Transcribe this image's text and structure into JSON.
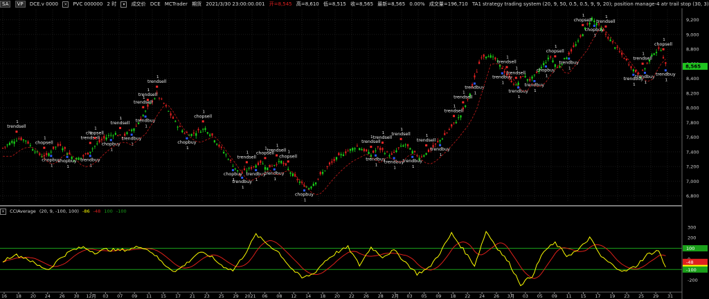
{
  "header": {
    "symbol_button": "SA",
    "vp_button": "VP",
    "symbol": "DCE.v 0000",
    "icon_names": [
      "close-icon",
      "settings-icon"
    ],
    "contract": "PVC 000000",
    "period": "2 时",
    "periodic_label": "成交价",
    "exchange": "DCE",
    "source": "MCTrader",
    "type_label": "期货",
    "datetime": "2021/3/30 23:00:00.001",
    "open_label": "开=8,545",
    "high_label": "高=8,610",
    "low_label": "低=8,515",
    "close_label": "收=8,565",
    "last_label": "最新=8,565",
    "change_label": "0.00%",
    "volume_label": "成交量=196,710",
    "strategy_label": "TA1 strategy trading system (20, 9, 50, 0.5, 0.5, 9, 9, 20); position manage-4 atr trail stop (30, 3)"
  },
  "price_axis": {
    "ticks": [
      "9,200",
      "9,000",
      "8,800",
      "8,600",
      "8,400",
      "8,200",
      "8,000",
      "7,800",
      "7,600",
      "7,400",
      "7,200",
      "7,000",
      "6,800"
    ],
    "last_price_label": "8,565",
    "last_price_color": "#1fc41f"
  },
  "indicator": {
    "title": "CCIAverage",
    "params": "(20, 9, -100, 100)",
    "value1": "-86",
    "value2": "-48",
    "value3": "100",
    "value4": "-100",
    "axis_ticks": [
      "300",
      "200",
      "100",
      "0",
      "-100",
      "-200"
    ],
    "badges": [
      "100",
      "-48",
      "-86",
      "-100"
    ],
    "colors": {
      "cci": "#ffff00",
      "avg": "#e0201a",
      "levels": "#1aa01a"
    }
  },
  "date_axis": {
    "labels": [
      "16",
      "18",
      "20",
      "24",
      "26",
      "30",
      "12月",
      "03",
      "07",
      "09",
      "11",
      "15",
      "17",
      "21",
      "23",
      "25",
      "29",
      "2021",
      "06",
      "08",
      "12",
      "14",
      "18",
      "20",
      "22",
      "26",
      "28",
      "2月",
      "03",
      "05",
      "09",
      "18",
      "22",
      "24",
      "26",
      "3月",
      "03",
      "05",
      "09",
      "11",
      "15",
      "17",
      "19",
      "23",
      "25",
      "29",
      "31"
    ]
  },
  "signals": [
    {
      "label": "trendsell"
    },
    {
      "label": "chopsell"
    },
    {
      "label": "chopbuy"
    },
    {
      "label": "trendbuy"
    },
    {
      "label": "1"
    }
  ],
  "chart_data": {
    "type": "candlestick",
    "price_axis": {
      "min": 6800,
      "max": 9300,
      "ticks": [
        6800,
        7000,
        7200,
        7400,
        7600,
        7800,
        8000,
        8200,
        8400,
        8600,
        8800,
        9000,
        9200
      ]
    },
    "close_path": [
      [
        0,
        7450
      ],
      [
        4,
        7540
      ],
      [
        7,
        7580
      ],
      [
        10,
        7560
      ],
      [
        13,
        7450
      ],
      [
        16,
        7360
      ],
      [
        19,
        7340
      ],
      [
        22,
        7450
      ],
      [
        25,
        7500
      ],
      [
        28,
        7400
      ],
      [
        31,
        7300
      ],
      [
        34,
        7320
      ],
      [
        37,
        7380
      ],
      [
        40,
        7480
      ],
      [
        43,
        7560
      ],
      [
        46,
        7620
      ],
      [
        49,
        7650
      ],
      [
        52,
        7600
      ],
      [
        55,
        7680
      ],
      [
        58,
        7750
      ],
      [
        61,
        7900
      ],
      [
        64,
        8050
      ],
      [
        67,
        8180
      ],
      [
        70,
        8060
      ],
      [
        73,
        7900
      ],
      [
        76,
        7760
      ],
      [
        79,
        7660
      ],
      [
        82,
        7640
      ],
      [
        85,
        7680
      ],
      [
        88,
        7720
      ],
      [
        91,
        7620
      ],
      [
        94,
        7480
      ],
      [
        97,
        7360
      ],
      [
        100,
        7220
      ],
      [
        103,
        7100
      ],
      [
        106,
        7150
      ],
      [
        109,
        7200
      ],
      [
        112,
        7260
      ],
      [
        115,
        7180
      ],
      [
        118,
        7230
      ],
      [
        121,
        7270
      ],
      [
        124,
        7160
      ],
      [
        127,
        7050
      ],
      [
        130,
        6960
      ],
      [
        133,
        6910
      ],
      [
        136,
        7000
      ],
      [
        139,
        7120
      ],
      [
        142,
        7220
      ],
      [
        145,
        7310
      ],
      [
        148,
        7380
      ],
      [
        151,
        7430
      ],
      [
        154,
        7480
      ],
      [
        157,
        7420
      ],
      [
        160,
        7360
      ],
      [
        163,
        7450
      ],
      [
        166,
        7400
      ],
      [
        169,
        7350
      ],
      [
        172,
        7450
      ],
      [
        175,
        7500
      ],
      [
        178,
        7400
      ],
      [
        181,
        7330
      ],
      [
        184,
        7380
      ],
      [
        187,
        7460
      ],
      [
        190,
        7560
      ],
      [
        193,
        7660
      ],
      [
        196,
        7780
      ],
      [
        199,
        7900
      ],
      [
        202,
        8100
      ],
      [
        205,
        8400
      ],
      [
        208,
        8700
      ],
      [
        211,
        8720
      ],
      [
        214,
        8660
      ],
      [
        217,
        8540
      ],
      [
        220,
        8400
      ],
      [
        223,
        8300
      ],
      [
        226,
        8440
      ],
      [
        229,
        8380
      ],
      [
        232,
        8460
      ],
      [
        235,
        8600
      ],
      [
        238,
        8700
      ],
      [
        241,
        8540
      ],
      [
        244,
        8660
      ],
      [
        247,
        8780
      ],
      [
        250,
        8900
      ],
      [
        253,
        9080
      ],
      [
        256,
        9220
      ],
      [
        259,
        9120
      ],
      [
        262,
        9000
      ],
      [
        265,
        8880
      ],
      [
        268,
        8760
      ],
      [
        271,
        8640
      ],
      [
        274,
        8520
      ],
      [
        277,
        8440
      ],
      [
        280,
        8600
      ],
      [
        283,
        8760
      ],
      [
        286,
        8800
      ],
      [
        288,
        8580
      ]
    ],
    "cci_path": [
      [
        0,
        -20
      ],
      [
        5,
        40
      ],
      [
        10,
        10
      ],
      [
        15,
        -60
      ],
      [
        20,
        -100
      ],
      [
        25,
        10
      ],
      [
        30,
        80
      ],
      [
        35,
        110
      ],
      [
        40,
        60
      ],
      [
        45,
        90
      ],
      [
        50,
        80
      ],
      [
        55,
        90
      ],
      [
        60,
        120
      ],
      [
        65,
        60
      ],
      [
        70,
        -50
      ],
      [
        75,
        -120
      ],
      [
        80,
        -40
      ],
      [
        85,
        60
      ],
      [
        90,
        30
      ],
      [
        95,
        -60
      ],
      [
        100,
        -110
      ],
      [
        105,
        40
      ],
      [
        110,
        230
      ],
      [
        115,
        140
      ],
      [
        120,
        60
      ],
      [
        125,
        -80
      ],
      [
        130,
        -180
      ],
      [
        135,
        -140
      ],
      [
        140,
        -20
      ],
      [
        145,
        60
      ],
      [
        150,
        110
      ],
      [
        155,
        -60
      ],
      [
        160,
        110
      ],
      [
        165,
        20
      ],
      [
        170,
        80
      ],
      [
        175,
        -30
      ],
      [
        180,
        -140
      ],
      [
        185,
        -90
      ],
      [
        190,
        60
      ],
      [
        195,
        240
      ],
      [
        200,
        90
      ],
      [
        205,
        -60
      ],
      [
        210,
        260
      ],
      [
        215,
        100
      ],
      [
        220,
        -40
      ],
      [
        225,
        -240
      ],
      [
        230,
        -160
      ],
      [
        235,
        70
      ],
      [
        240,
        150
      ],
      [
        245,
        30
      ],
      [
        250,
        80
      ],
      [
        255,
        200
      ],
      [
        260,
        20
      ],
      [
        265,
        -60
      ],
      [
        270,
        -120
      ],
      [
        275,
        -70
      ],
      [
        280,
        40
      ],
      [
        285,
        80
      ],
      [
        288,
        -86
      ]
    ]
  }
}
